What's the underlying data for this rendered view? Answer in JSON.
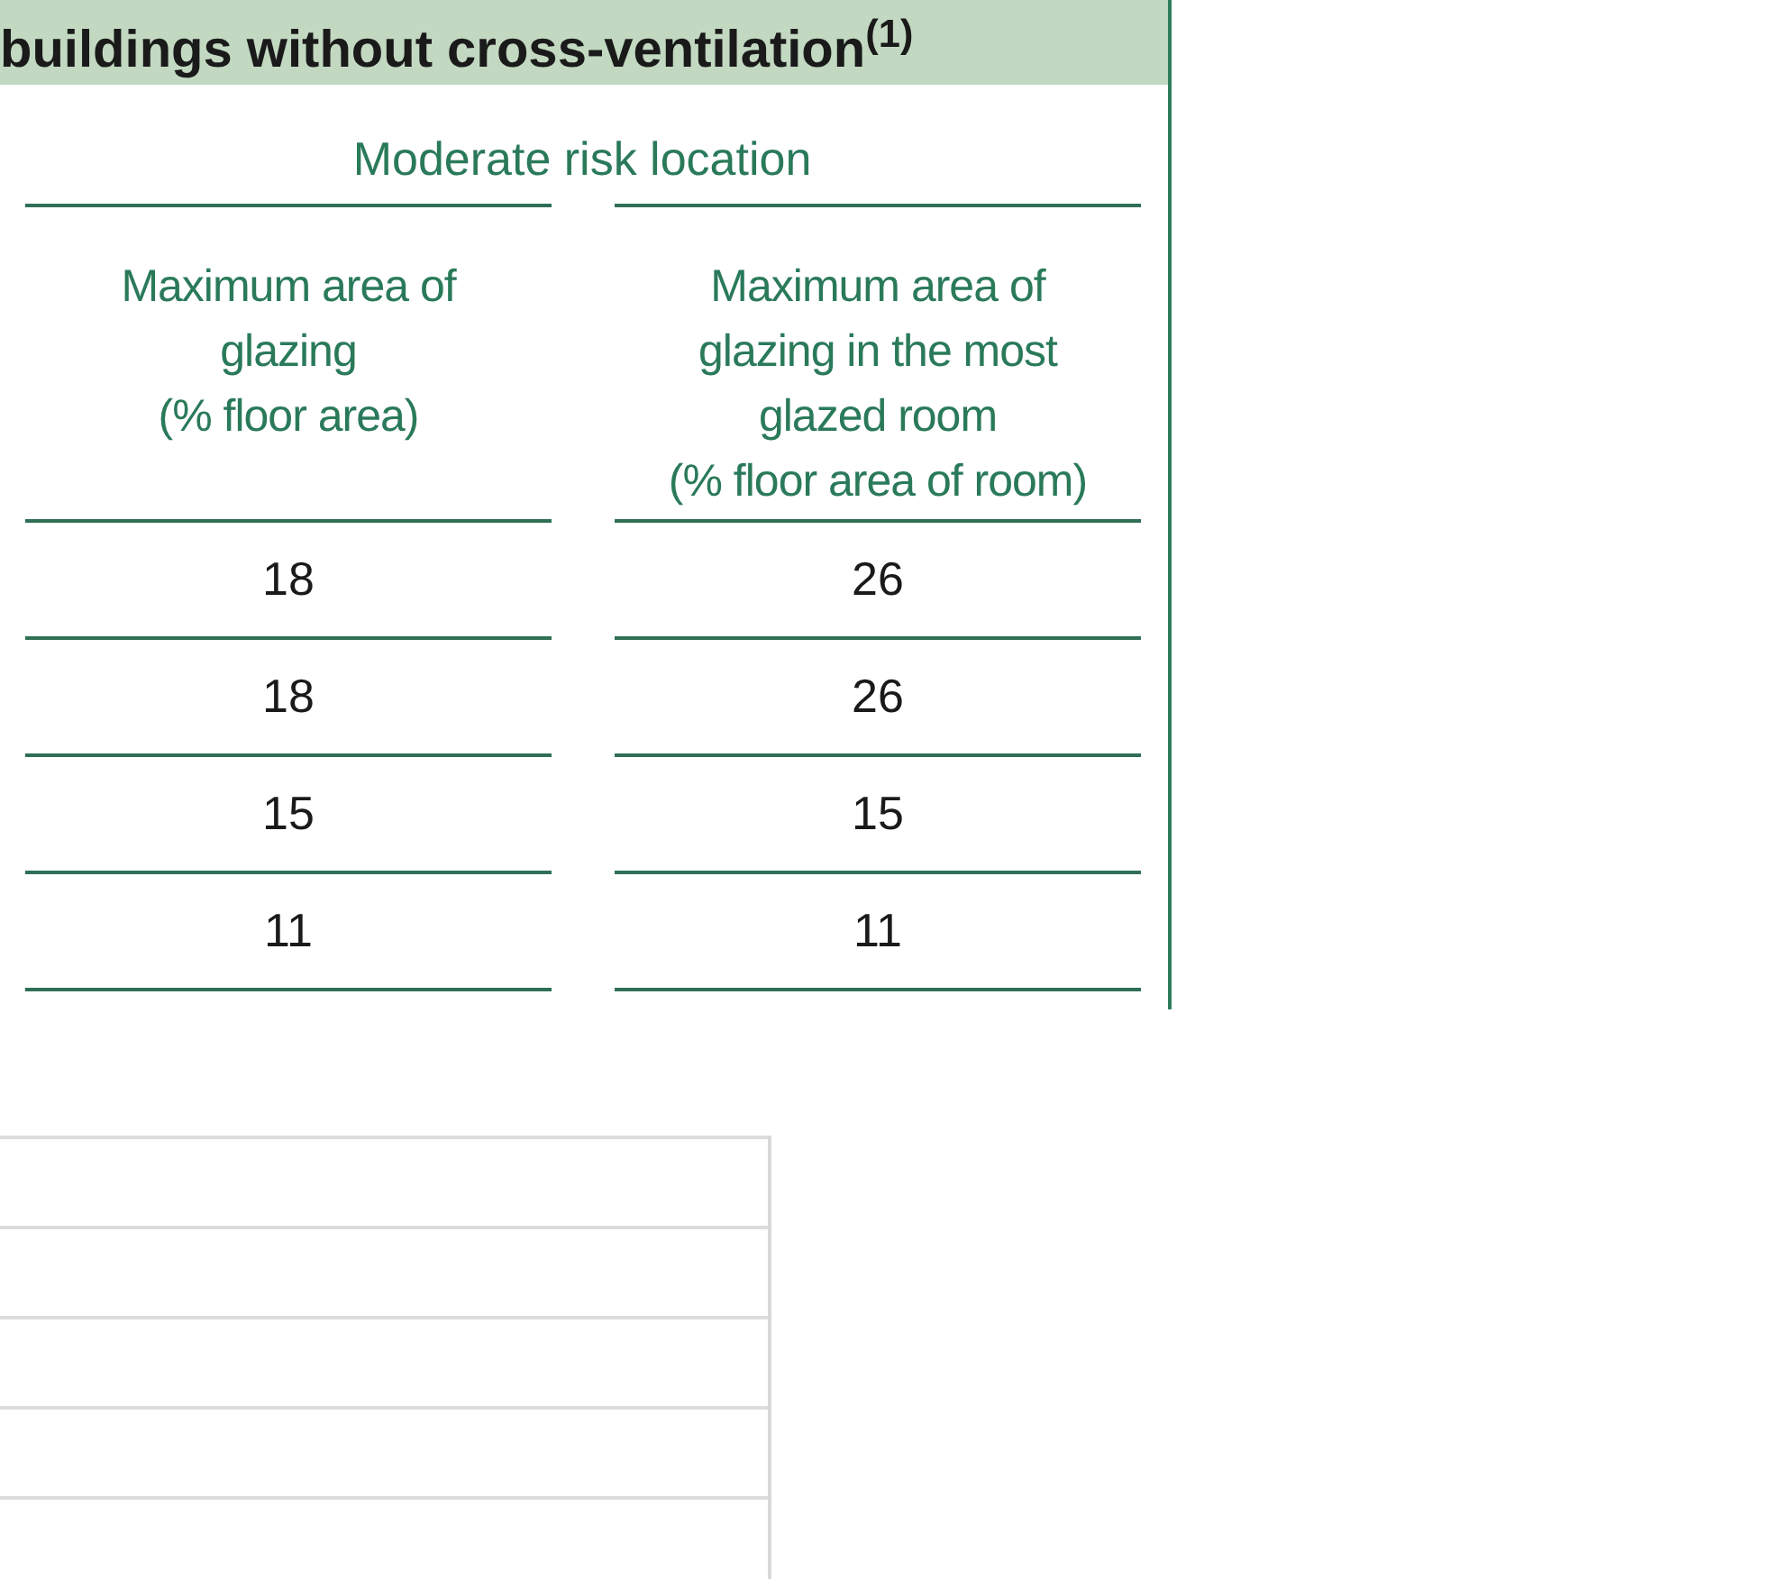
{
  "table": {
    "title": "buildings without cross-ventilation$^{(1)}$",
    "group_heading": "Moderate risk location",
    "columns": [
      {
        "lines": [
          "Maximum area of",
          "glazing",
          "(% floor area)"
        ]
      },
      {
        "lines": [
          "Maximum area of",
          "glazing in the most",
          "glazed room",
          "(% floor area of room)"
        ]
      }
    ],
    "rows": [
      [
        "18",
        "26"
      ],
      [
        "18",
        "26"
      ],
      [
        "15",
        "15"
      ],
      [
        "11",
        "11"
      ]
    ]
  }
}
